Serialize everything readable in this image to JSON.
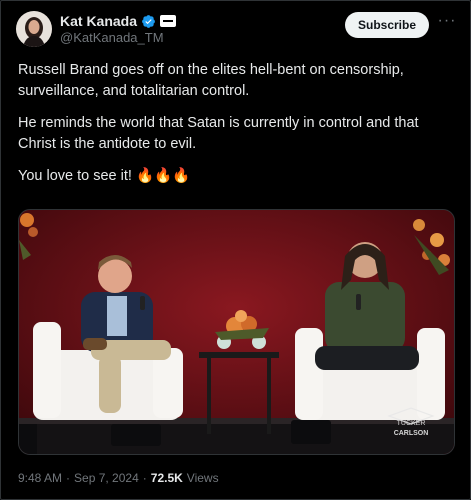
{
  "author": {
    "name": "Kat Kanada",
    "handle": "@KatKanada_TM"
  },
  "actions": {
    "subscribe_label": "Subscribe",
    "more_label": "···"
  },
  "tweet": {
    "paragraphs": [
      "Russell Brand goes off on the elites hell-bent on censorship, surveillance, and totalitarian control.",
      "He reminds the world that Satan is currently in control and that Christ is the antidote to evil.",
      "You love to see it! 🔥🔥🔥"
    ]
  },
  "media": {
    "watermark_line1": "TUCKER",
    "watermark_line2": "CARLSON"
  },
  "meta": {
    "time": "9:48 AM",
    "separator": "·",
    "date": "Sep 7, 2024",
    "views_count": "72.5K",
    "views_label": "Views"
  },
  "colors": {
    "background": "#000000",
    "verified_badge": "#1d9bf0",
    "stage_red": "#6b1218"
  }
}
